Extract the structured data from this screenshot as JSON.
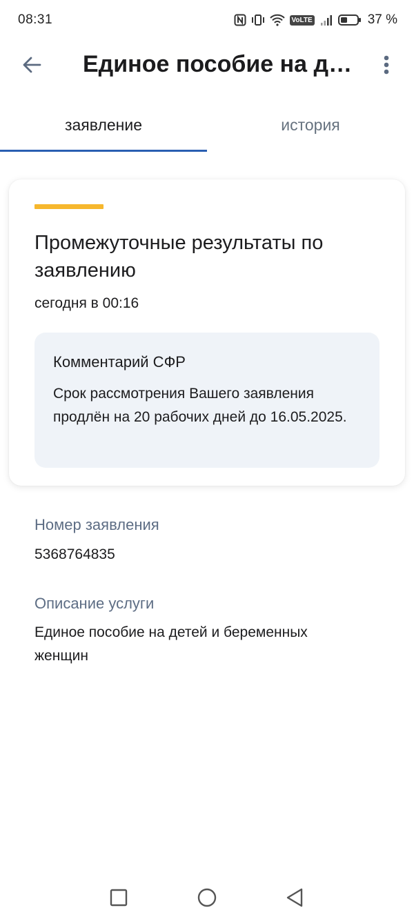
{
  "status_bar": {
    "time": "08:31",
    "volte": "VoLTE",
    "battery_percent": "37 %",
    "icons": [
      "nfc-icon",
      "vibrate-icon",
      "wifi-icon",
      "volte-icon",
      "signal-icon",
      "battery-icon"
    ]
  },
  "header": {
    "title": "Единое пособие на де…",
    "back_icon": "arrow-left-icon",
    "more_icon": "more-vertical-icon"
  },
  "tabs": [
    {
      "label": "заявление",
      "active": true
    },
    {
      "label": "история",
      "active": false
    }
  ],
  "card": {
    "title": "Промежуточные результаты по заявлению",
    "date": "сегодня в 00:16",
    "comment": {
      "title": "Комментарий СФР",
      "text": "Срок рассмотрения Вашего заявления продлён на 20 рабочих дней до 16.05.2025."
    }
  },
  "details": {
    "number_label": "Номер заявления",
    "number_value": "5368764835",
    "description_label": "Описание услуги",
    "description_value": "Единое пособие на детей и беременных женщин"
  },
  "colors": {
    "accent": "#f6b72d",
    "tab_underline": "#2a5fb2",
    "label": "#5d6d84",
    "comment_bg": "#eff3f8"
  },
  "nav_bar": {
    "icons": [
      "recents-square-icon",
      "home-circle-icon",
      "back-triangle-icon"
    ]
  }
}
